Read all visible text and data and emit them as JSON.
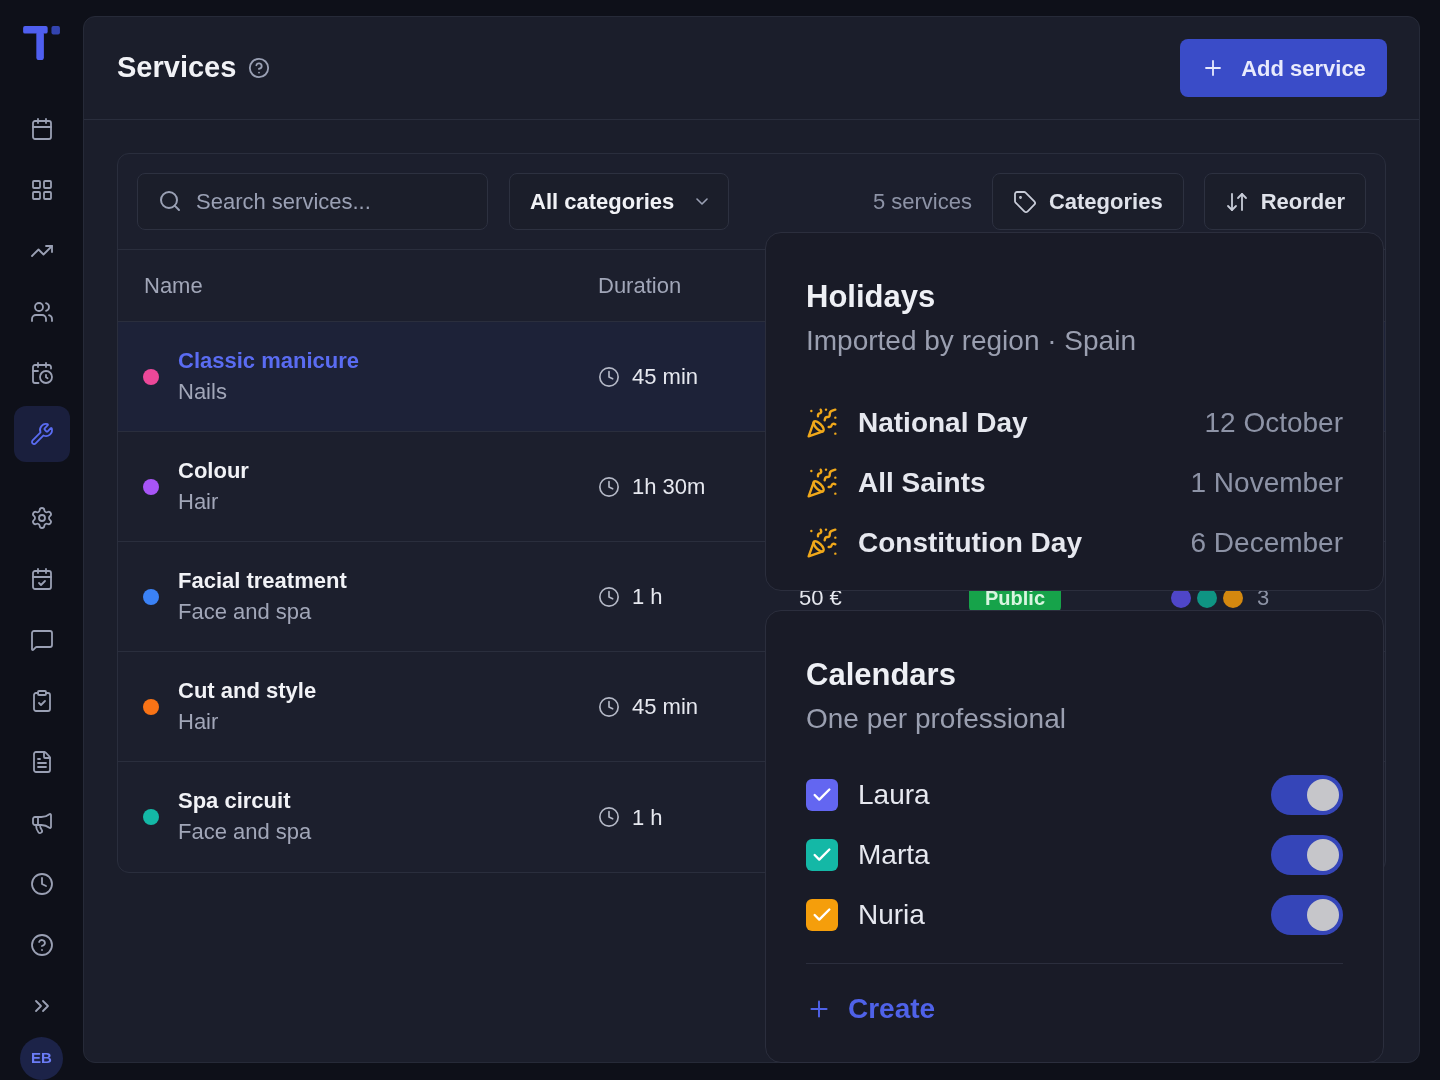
{
  "sidebar": {
    "items": [
      {
        "kind": "calendar",
        "selected": false
      },
      {
        "kind": "grid",
        "selected": false
      },
      {
        "kind": "trend",
        "selected": false
      },
      {
        "kind": "users",
        "selected": false
      },
      {
        "kind": "calendar-clock",
        "selected": false
      },
      {
        "kind": "wrench",
        "selected": true
      },
      {
        "kind": "settings",
        "selected": false
      },
      {
        "kind": "calendar-check",
        "selected": false
      },
      {
        "kind": "message",
        "selected": false
      },
      {
        "kind": "clipboard",
        "selected": false
      },
      {
        "kind": "file",
        "selected": false
      },
      {
        "kind": "megaphone",
        "selected": false
      },
      {
        "kind": "clock",
        "selected": false
      },
      {
        "kind": "help",
        "selected": false
      },
      {
        "kind": "expand",
        "selected": false
      }
    ],
    "avatar": "EB"
  },
  "header": {
    "title": "Services",
    "button": "Add service"
  },
  "toolbar": {
    "search": {
      "placeholder": "Search services..."
    },
    "category_filter": "All categories",
    "count": "5 services",
    "buttons": [
      {
        "kind": "categories",
        "label": "Categories"
      },
      {
        "kind": "reorder",
        "label": "Reorder"
      }
    ]
  },
  "table": {
    "columns": [
      "Name",
      "Duration"
    ],
    "rows": [
      {
        "name": "Classic manicure",
        "category": "Nails",
        "duration": "45 min",
        "color": "#ec4899",
        "selected": true
      },
      {
        "name": "Colour",
        "category": "Hair",
        "duration": "1h 30m",
        "color": "#a855f7",
        "selected": false
      },
      {
        "name": "Facial treatment",
        "category": "Face and spa",
        "duration": "1 h",
        "color": "#3b82f6",
        "selected": false,
        "price": "50 €",
        "visibility": "Public",
        "team": [
          {
            "color": "#4f46c8"
          },
          {
            "color": "#0f9483"
          },
          {
            "color": "#d4880f"
          }
        ],
        "team_count": "3"
      },
      {
        "name": "Cut and style",
        "category": "Hair",
        "duration": "45 min",
        "color": "#f97316",
        "selected": false
      },
      {
        "name": "Spa circuit",
        "category": "Face and spa",
        "duration": "1 h",
        "color": "#14b8a6",
        "selected": false
      }
    ]
  },
  "holidays": {
    "title": "Holidays",
    "subtitle": "Imported by region · Spain",
    "items": [
      {
        "name": "National Day",
        "date": "12 October"
      },
      {
        "name": "All Saints",
        "date": "1 November"
      },
      {
        "name": "Constitution Day",
        "date": "6 December"
      }
    ]
  },
  "calendars": {
    "title": "Calendars",
    "subtitle": "One per professional",
    "items": [
      {
        "name": "Laura",
        "color": "#6366f1",
        "checked": true,
        "on": true
      },
      {
        "name": "Marta",
        "color": "#14b8a6",
        "checked": true,
        "on": true
      },
      {
        "name": "Nuria",
        "color": "#f59e0b",
        "checked": true,
        "on": true
      }
    ],
    "create": "Create"
  }
}
